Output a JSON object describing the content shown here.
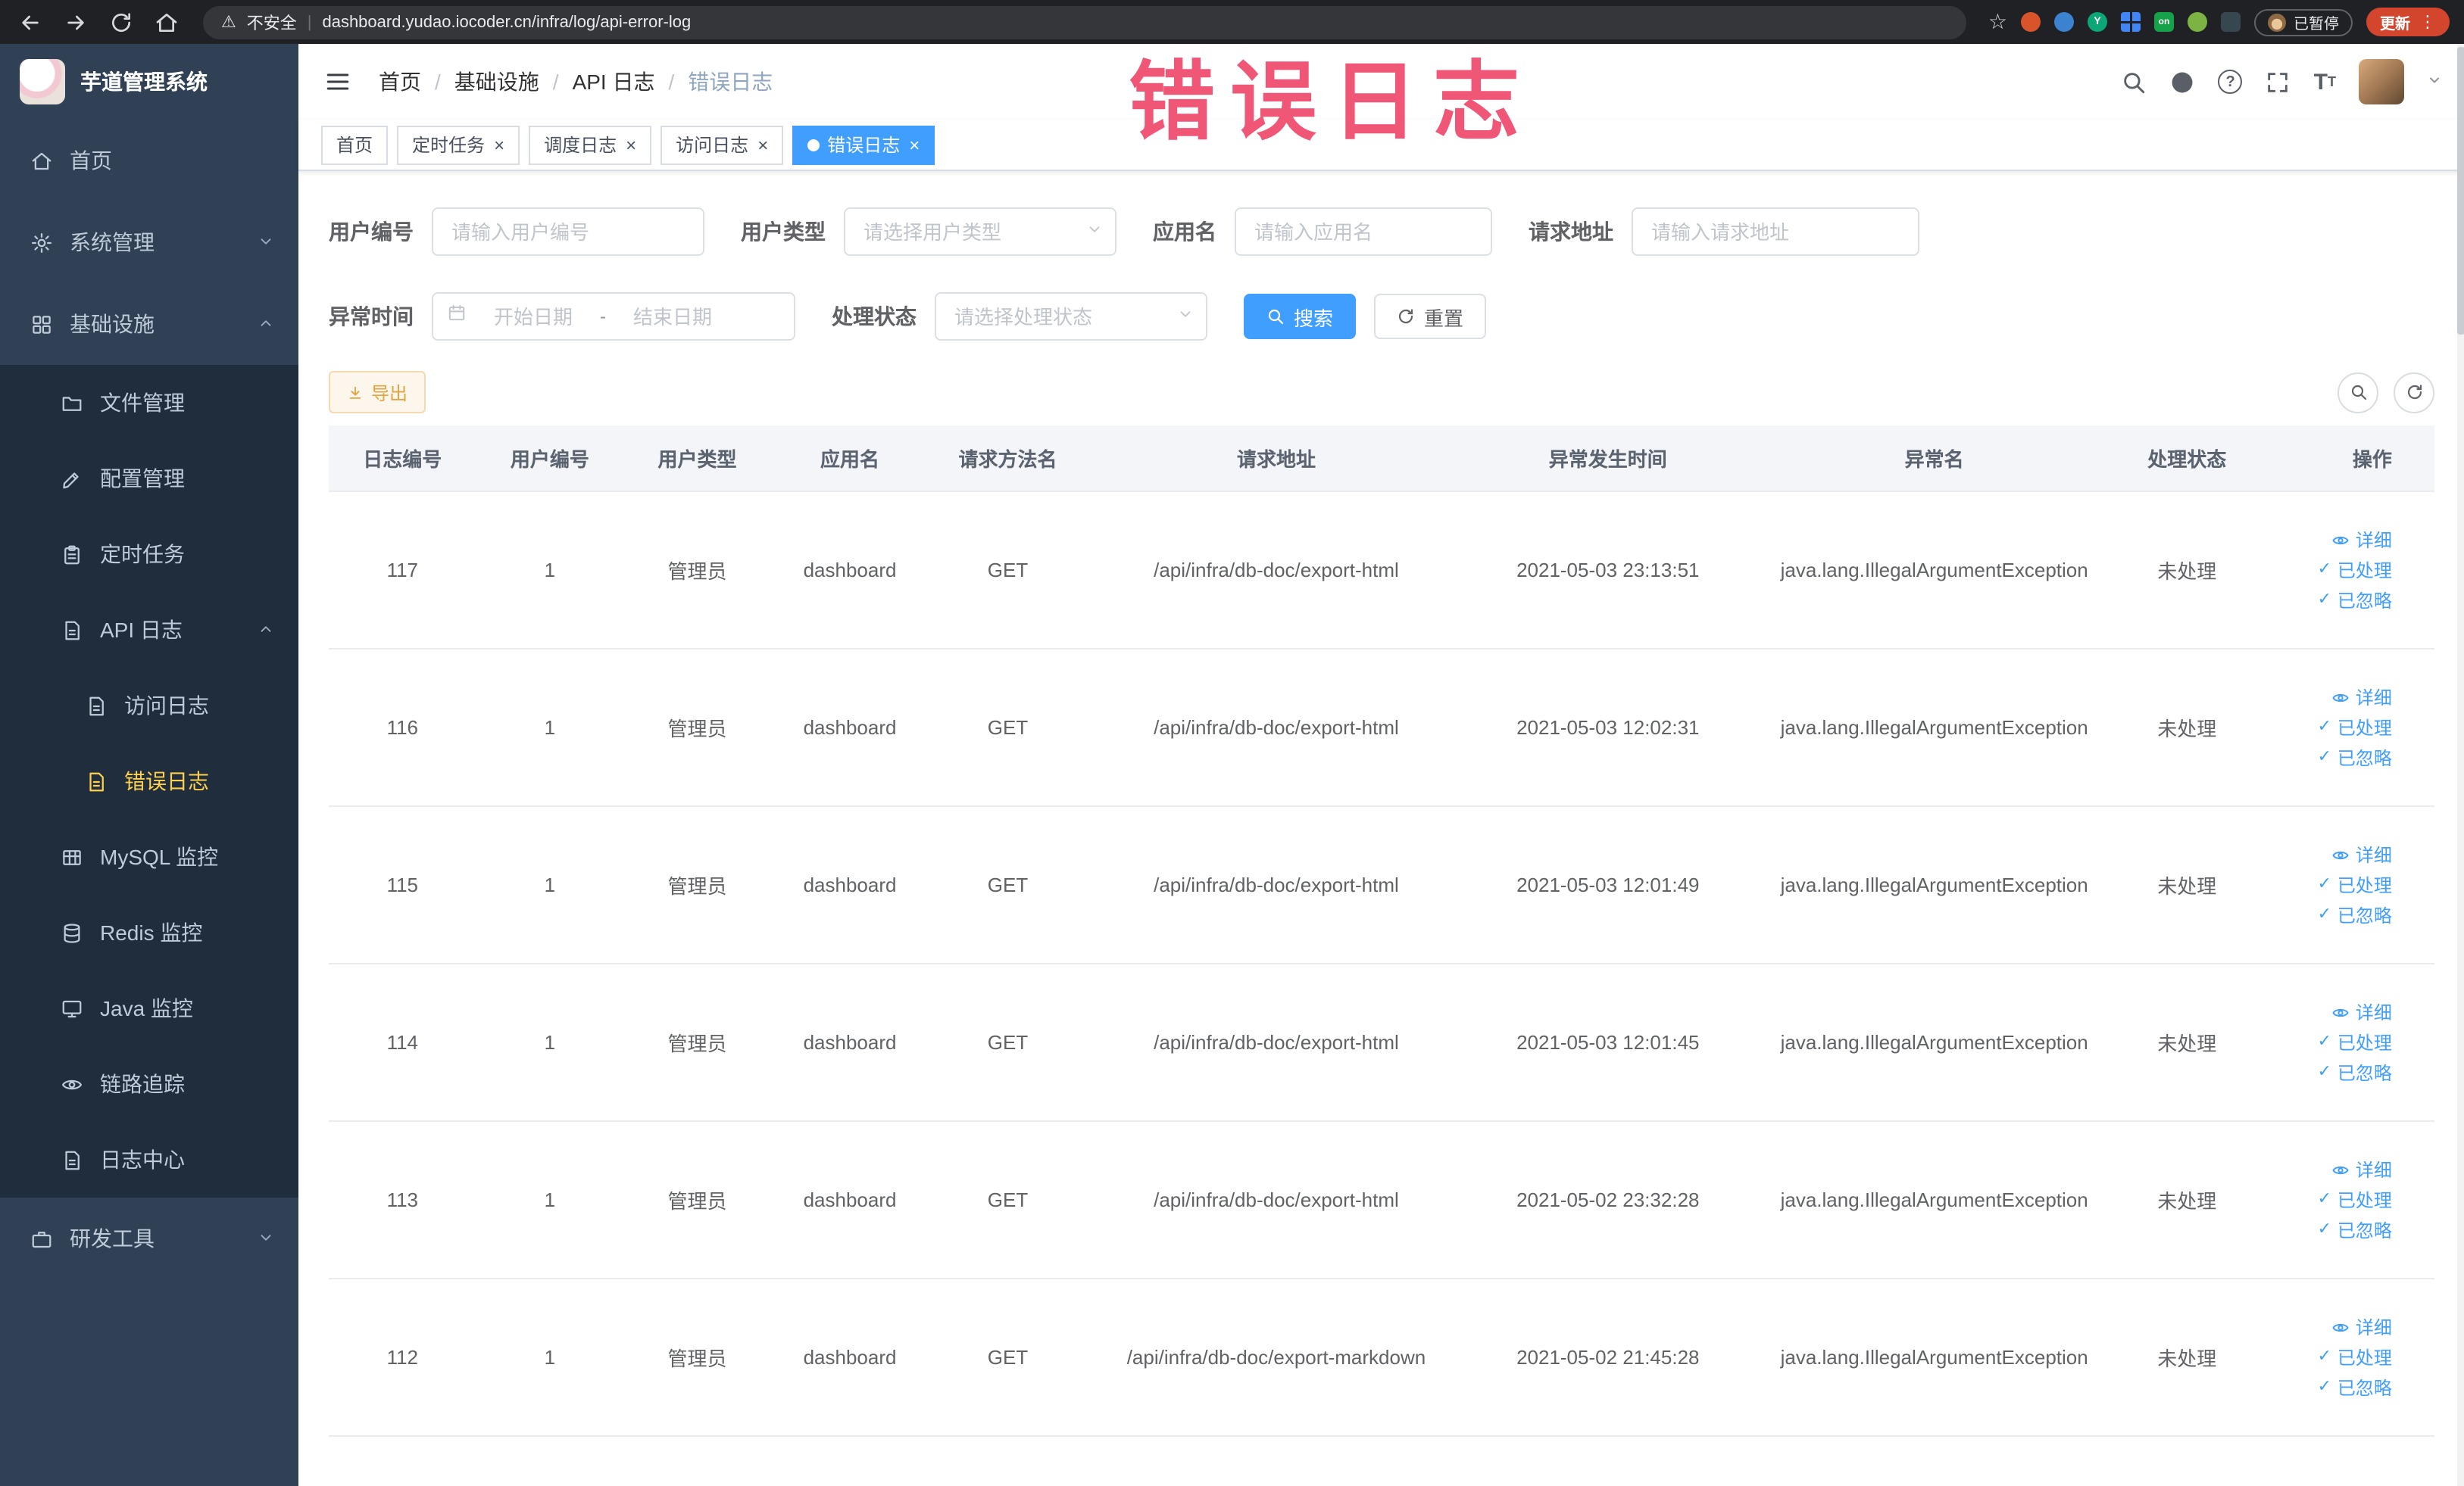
{
  "browser": {
    "security_label": "不安全",
    "url": "dashboard.yudao.iocoder.cn/infra/log/api-error-log",
    "paused_badge": "已暂停",
    "update_label": "更新"
  },
  "watermark": "错误日志",
  "sidebar": {
    "logo_title": "芋道管理系统",
    "items": {
      "home": "首页",
      "system": "系统管理",
      "infra": "基础设施",
      "file": "文件管理",
      "config": "配置管理",
      "job": "定时任务",
      "api_log": "API 日志",
      "access_log": "访问日志",
      "error_log": "错误日志",
      "mysql": "MySQL 监控",
      "redis": "Redis 监控",
      "java": "Java 监控",
      "trace": "链路追踪",
      "log_center": "日志中心",
      "devtools": "研发工具"
    }
  },
  "header": {
    "breadcrumb": [
      "首页",
      "基础设施",
      "API 日志",
      "错误日志"
    ]
  },
  "tabs": [
    {
      "label": "首页"
    },
    {
      "label": "定时任务"
    },
    {
      "label": "调度日志"
    },
    {
      "label": "访问日志"
    },
    {
      "label": "错误日志"
    }
  ],
  "filters": {
    "user_id_label": "用户编号",
    "user_id_placeholder": "请输入用户编号",
    "user_type_label": "用户类型",
    "user_type_placeholder": "请选择用户类型",
    "app_name_label": "应用名",
    "app_name_placeholder": "请输入应用名",
    "request_url_label": "请求地址",
    "request_url_placeholder": "请输入请求地址",
    "exception_time_label": "异常时间",
    "start_date_placeholder": "开始日期",
    "range_separator": "-",
    "end_date_placeholder": "结束日期",
    "process_status_label": "处理状态",
    "process_status_placeholder": "请选择处理状态",
    "search_button": "搜索",
    "reset_button": "重置"
  },
  "toolbar": {
    "export_button": "导出"
  },
  "table": {
    "columns": [
      "日志编号",
      "用户编号",
      "用户类型",
      "应用名",
      "请求方法名",
      "请求地址",
      "异常发生时间",
      "异常名",
      "处理状态",
      "操作"
    ],
    "actions": {
      "detail": "详细",
      "processed": "已处理",
      "ignored": "已忽略"
    },
    "rows": [
      {
        "id": "117",
        "user_id": "1",
        "user_type": "管理员",
        "app": "dashboard",
        "method": "GET",
        "url": "/api/infra/db-doc/export-html",
        "time": "2021-05-03 23:13:51",
        "exception": "java.lang.IllegalArgumentException",
        "status": "未处理"
      },
      {
        "id": "116",
        "user_id": "1",
        "user_type": "管理员",
        "app": "dashboard",
        "method": "GET",
        "url": "/api/infra/db-doc/export-html",
        "time": "2021-05-03 12:02:31",
        "exception": "java.lang.IllegalArgumentException",
        "status": "未处理"
      },
      {
        "id": "115",
        "user_id": "1",
        "user_type": "管理员",
        "app": "dashboard",
        "method": "GET",
        "url": "/api/infra/db-doc/export-html",
        "time": "2021-05-03 12:01:49",
        "exception": "java.lang.IllegalArgumentException",
        "status": "未处理"
      },
      {
        "id": "114",
        "user_id": "1",
        "user_type": "管理员",
        "app": "dashboard",
        "method": "GET",
        "url": "/api/infra/db-doc/export-html",
        "time": "2021-05-03 12:01:45",
        "exception": "java.lang.IllegalArgumentException",
        "status": "未处理"
      },
      {
        "id": "113",
        "user_id": "1",
        "user_type": "管理员",
        "app": "dashboard",
        "method": "GET",
        "url": "/api/infra/db-doc/export-html",
        "time": "2021-05-02 23:32:28",
        "exception": "java.lang.IllegalArgumentException",
        "status": "未处理"
      },
      {
        "id": "112",
        "user_id": "1",
        "user_type": "管理员",
        "app": "dashboard",
        "method": "GET",
        "url": "/api/infra/db-doc/export-markdown",
        "time": "2021-05-02 21:45:28",
        "exception": "java.lang.IllegalArgumentException",
        "status": "未处理"
      }
    ]
  }
}
